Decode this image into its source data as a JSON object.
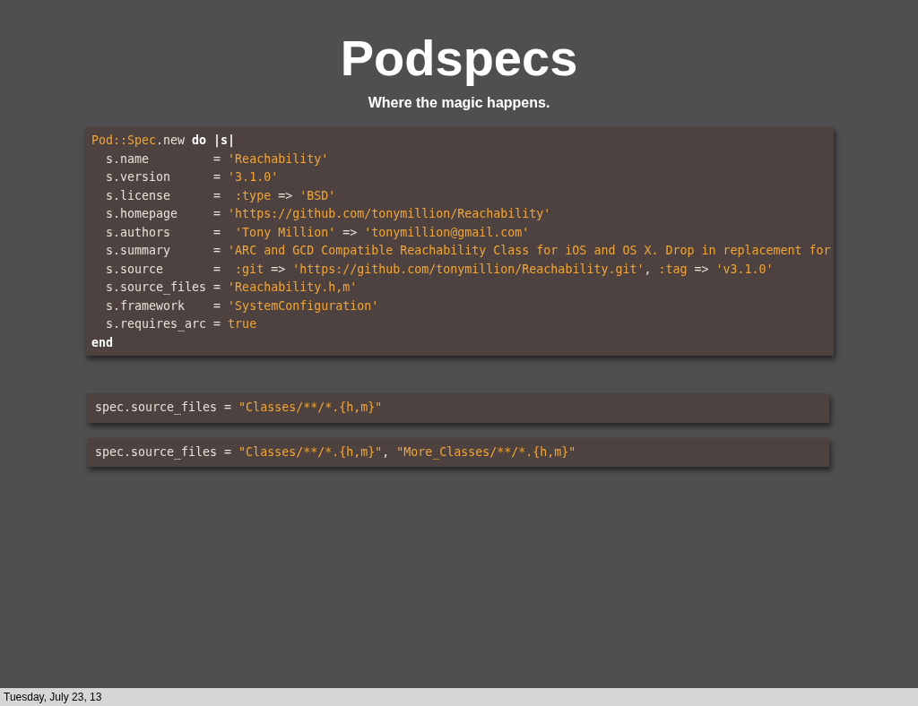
{
  "slide": {
    "title": "Podspecs",
    "subtitle": "Where the magic happens.",
    "code_blocks": [
      {
        "lines": [
          [
            {
              "kind": "accent",
              "text": "Pod::Spec"
            },
            {
              "kind": "plain",
              "text": ".new "
            },
            {
              "kind": "keyword",
              "text": "do |s|"
            }
          ],
          [
            {
              "kind": "plain",
              "text": "  s.name         = "
            },
            {
              "kind": "accent",
              "text": "'Reachability'"
            }
          ],
          [
            {
              "kind": "plain",
              "text": "  s.version      = "
            },
            {
              "kind": "accent",
              "text": "'3.1.0'"
            }
          ],
          [
            {
              "kind": "plain",
              "text": "  s.license      =  "
            },
            {
              "kind": "accent",
              "text": ":type "
            },
            {
              "kind": "plain",
              "text": "=> "
            },
            {
              "kind": "accent",
              "text": "'BSD'"
            }
          ],
          [
            {
              "kind": "plain",
              "text": "  s.homepage     = "
            },
            {
              "kind": "accent",
              "text": "'https://github.com/tonymillion/Reachability'"
            }
          ],
          [
            {
              "kind": "plain",
              "text": "  s.authors      =  "
            },
            {
              "kind": "accent",
              "text": "'Tony Million' "
            },
            {
              "kind": "plain",
              "text": "=> "
            },
            {
              "kind": "accent",
              "text": "'tonymillion@gmail.com'"
            }
          ],
          [
            {
              "kind": "plain",
              "text": "  s.summary      = "
            },
            {
              "kind": "accent",
              "text": "'ARC and GCD Compatible Reachability Class for iOS and OS X. Drop in replacement for"
            }
          ],
          [
            {
              "kind": "plain",
              "text": "  s.source       =  "
            },
            {
              "kind": "accent",
              "text": ":git "
            },
            {
              "kind": "plain",
              "text": "=> "
            },
            {
              "kind": "accent",
              "text": "'https://github.com/tonymillion/Reachability.git'"
            },
            {
              "kind": "plain",
              "text": ", "
            },
            {
              "kind": "accent",
              "text": ":tag "
            },
            {
              "kind": "plain",
              "text": "=> "
            },
            {
              "kind": "accent",
              "text": "'v3.1.0'"
            }
          ],
          [
            {
              "kind": "plain",
              "text": "  s.source_files = "
            },
            {
              "kind": "accent",
              "text": "'Reachability.h,m'"
            }
          ],
          [
            {
              "kind": "plain",
              "text": "  s.framework    = "
            },
            {
              "kind": "accent",
              "text": "'SystemConfiguration'"
            }
          ],
          [
            {
              "kind": "plain",
              "text": "  s.requires_arc = "
            },
            {
              "kind": "accent",
              "text": "true"
            }
          ],
          [
            {
              "kind": "keyword",
              "text": "end"
            }
          ]
        ]
      },
      {
        "lines": [
          [
            {
              "kind": "plain",
              "text": "spec.source_files = "
            },
            {
              "kind": "accent",
              "text": "\"Classes/**/*.{h,m}\""
            }
          ]
        ]
      },
      {
        "lines": [
          [
            {
              "kind": "plain",
              "text": "spec.source_files = "
            },
            {
              "kind": "accent",
              "text": "\"Classes/**/*.{h,m}\""
            },
            {
              "kind": "plain",
              "text": ", "
            },
            {
              "kind": "accent",
              "text": "\"More_Classes/**/*.{h,m}\""
            }
          ]
        ]
      }
    ]
  },
  "footer": {
    "date": "Tuesday, July 23, 13"
  }
}
